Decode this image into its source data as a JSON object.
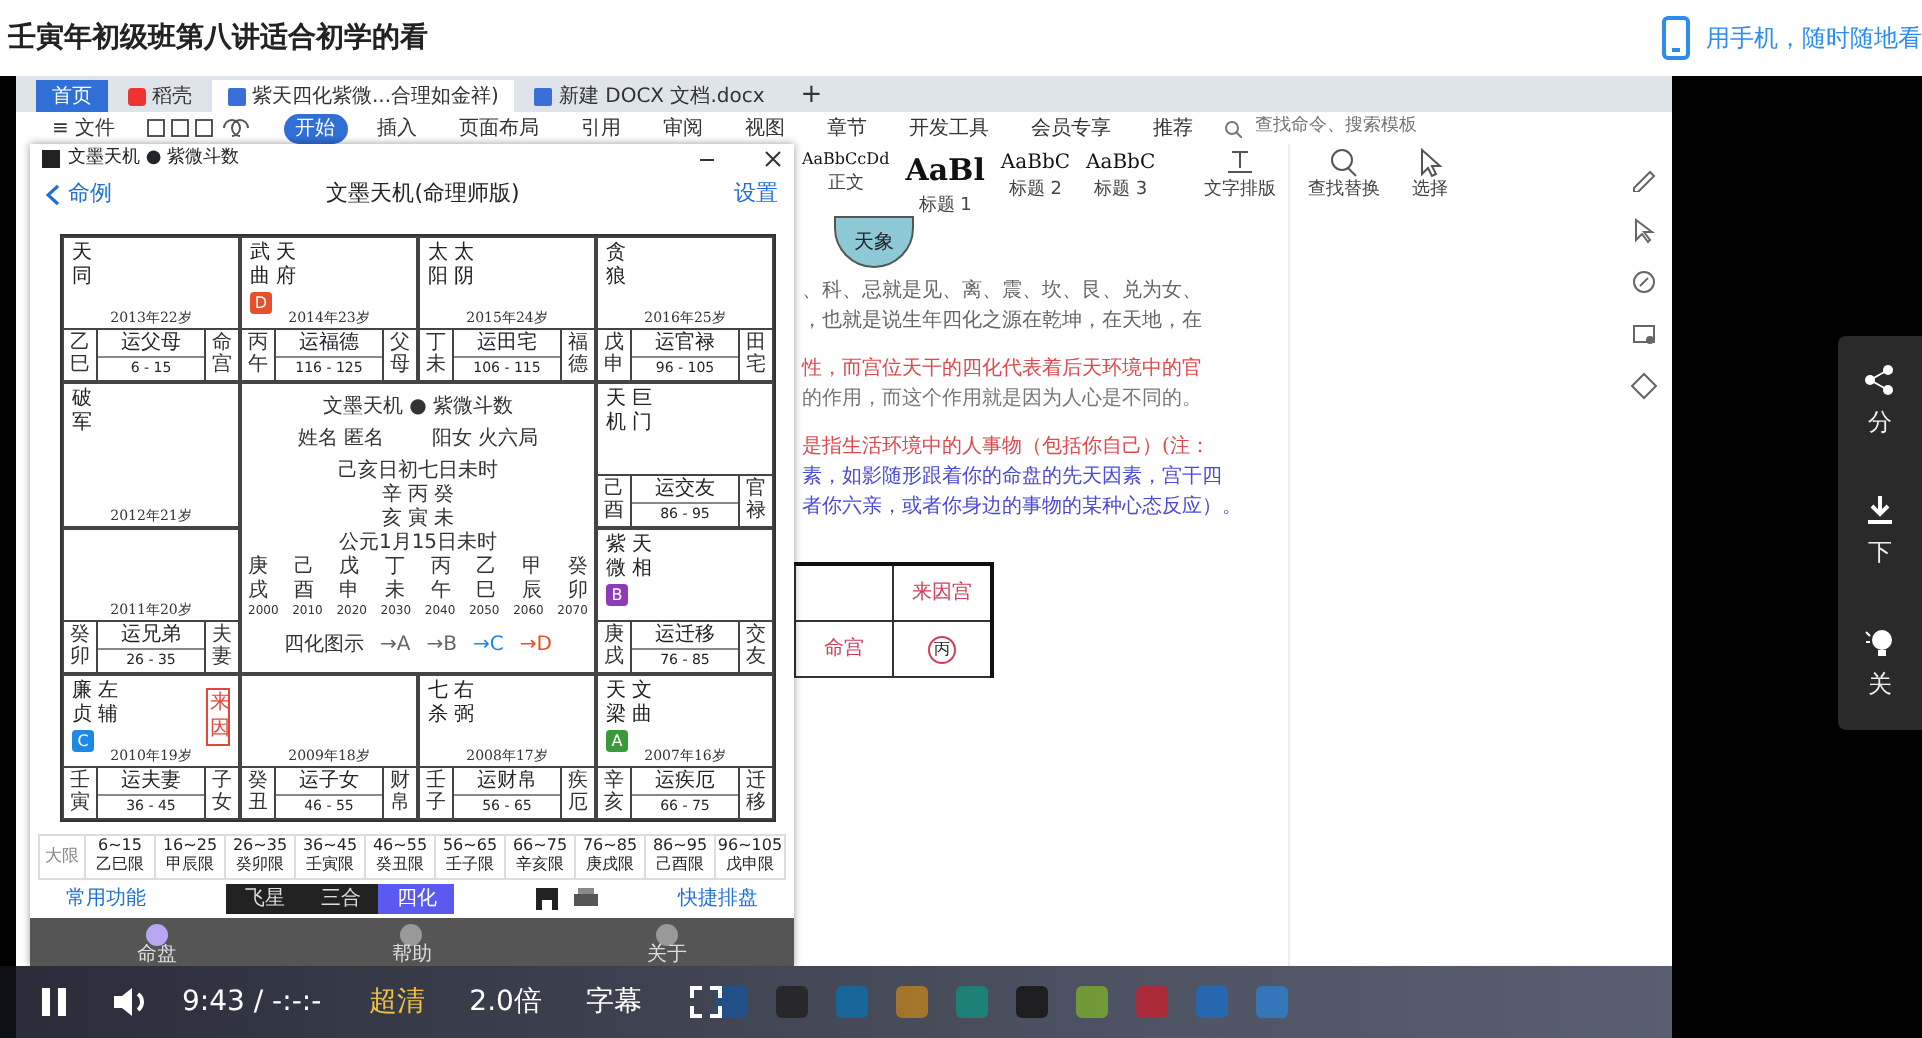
{
  "page_title": "壬寅年初级班第八讲适合初学的看",
  "mobile_link": "用手机，随时随地看",
  "browser_tabs": [
    {
      "label": "首页",
      "kind": "home",
      "selected": false
    },
    {
      "label": "稻壳",
      "kind": "app",
      "selected": false
    },
    {
      "label": "紫天四化紫微...合理如金祥)",
      "kind": "doc",
      "selected": true
    },
    {
      "label": "新建 DOCX 文档.docx",
      "kind": "doc",
      "selected": false
    },
    {
      "label": "+",
      "kind": "add",
      "selected": false
    }
  ],
  "ribbon_menu": [
    {
      "label": "≡ 文件",
      "selected": false
    },
    {
      "label": "开始",
      "selected": true
    },
    {
      "label": "插入",
      "selected": false
    },
    {
      "label": "页面布局",
      "selected": false
    },
    {
      "label": "引用",
      "selected": false
    },
    {
      "label": "审阅",
      "selected": false
    },
    {
      "label": "视图",
      "selected": false
    },
    {
      "label": "章节",
      "selected": false
    },
    {
      "label": "开发工具",
      "selected": false
    },
    {
      "label": "会员专享",
      "selected": false
    },
    {
      "label": "推荐",
      "selected": false
    }
  ],
  "command_search": {
    "placeholder": "查找命令、搜索模板"
  },
  "styles": [
    {
      "sample": "AaBbCcDd",
      "label": "正文",
      "kind": "small"
    },
    {
      "sample": "AaBl",
      "label": "标题 1",
      "kind": "large"
    },
    {
      "sample": "AaBbC",
      "label": "标题 2",
      "kind": "medium"
    },
    {
      "sample": "AaBbC",
      "label": "标题 3",
      "kind": "medium"
    }
  ],
  "ribbon_tools": [
    {
      "label": "文字排版",
      "kind": "text"
    },
    {
      "label": "查找替换",
      "kind": "search"
    },
    {
      "label": "选择",
      "kind": "cursor"
    }
  ],
  "document": {
    "circle_label": "天象",
    "lines": [
      {
        "text": "、科、忌就是见、离、震、坎、艮、兑为女、",
        "color": "#666666"
      },
      {
        "text": "，也就是说生年四化之源在乾坤，在天地，在",
        "color": "#666666"
      },
      {
        "text": "性，而宫位天干的四化代表着后天环境中的官",
        "color": "#e0484c"
      },
      {
        "text": "的作用，而这个作用就是因为人心是不同的。",
        "color": "#777777"
      },
      {
        "text": "是指生活环境中的人事物（包括你自己）(注：",
        "color": "#e0484c"
      },
      {
        "text": "素，如影随形跟着你的命盘的先天因素，宫干四",
        "color": "#4a4ad8"
      },
      {
        "text": "者你六亲，或者你身边的事物的某种心态反应）。",
        "color": "#4a4ad8"
      }
    ],
    "table": {
      "corner": "来因宫",
      "palace": "命宫",
      "stem": "丙"
    }
  },
  "chart_app": {
    "window_title": "文墨天机 ● 紫微斗数",
    "back": "命例",
    "title": "文墨天机(命理师版)",
    "settings": "设置",
    "palaces": [
      {
        "stars": [
          "天同"
        ],
        "year": "2013年22岁",
        "stem": "乙巳",
        "yun": "运父母",
        "range": "6 - 15",
        "name": "命宫"
      },
      {
        "stars": [
          "武曲",
          "天府"
        ],
        "badge": {
          "text": "D",
          "color": "#e8502c"
        },
        "year": "2014年23岁",
        "stem": "丙午",
        "yun": "运福德",
        "range": "116 - 125",
        "name": "父母"
      },
      {
        "stars": [
          "太阳",
          "太阴"
        ],
        "year": "2015年24岁",
        "stem": "丁未",
        "yun": "运田宅",
        "range": "106 - 115",
        "name": "福德"
      },
      {
        "stars": [
          "贪狼"
        ],
        "year": "2016年25岁",
        "stem": "戊申",
        "yun": "运官禄",
        "range": "96 - 105",
        "name": "田宅"
      },
      {
        "stars": [
          "破军"
        ],
        "year": "2012年21岁"
      },
      {
        "stars": [
          "天机",
          "巨门"
        ],
        "stem": "己酉",
        "yun": "运交友",
        "range": "86 - 95",
        "name": "官禄"
      },
      {
        "year": "2011年20岁",
        "stem": "癸卯",
        "yun": "运兄弟",
        "range": "26 - 35",
        "name": "夫妻"
      },
      {
        "stars": [
          "紫微",
          "天相"
        ],
        "badge": {
          "text": "B",
          "color": "#8e3bb8"
        },
        "stem": "庚戌",
        "yun": "运迁移",
        "range": "76 - 85",
        "name": "交友"
      },
      {
        "stars": [
          "廉贞",
          "左辅"
        ],
        "badge": {
          "text": "C",
          "color": "#1e88e5"
        },
        "tag": "来因",
        "year": "2010年19岁",
        "stem": "壬寅",
        "yun": "运夫妻",
        "range": "36 - 45",
        "name": "子女"
      },
      {
        "year": "2009年18岁",
        "stem": "癸丑",
        "yun": "运子女",
        "range": "46 - 55",
        "name": "财帛"
      },
      {
        "stars": [
          "七杀",
          "右弼"
        ],
        "year": "2008年17岁",
        "stem": "壬子",
        "yun": "运财帛",
        "range": "56 - 65",
        "name": "疾厄"
      },
      {
        "stars": [
          "天梁",
          "文曲"
        ],
        "badge": {
          "text": "A",
          "color": "#3a9a3a"
        },
        "year": "2007年16岁",
        "stem": "辛亥",
        "yun": "运疾厄",
        "range": "66 - 75",
        "name": "迁移"
      }
    ],
    "center": {
      "title": "文墨天机 ● 紫微斗数",
      "info": [
        "姓名 匿名",
        "阳女 火六局"
      ],
      "birth": [
        "己亥日初七日未时",
        "辛 丙 癸",
        "亥 寅 未",
        "公元1月15日未时"
      ],
      "stems": [
        "庚",
        "己",
        "戊",
        "丁",
        "丙",
        "乙",
        "甲",
        "癸"
      ],
      "branches": [
        "戌",
        "酉",
        "申",
        "未",
        "午",
        "巳",
        "辰",
        "卯"
      ],
      "years": [
        "2000",
        "2010",
        "2020",
        "2030",
        "2040",
        "2050",
        "2060",
        "2070"
      ],
      "legend_label": "四化图示",
      "legend": [
        {
          "text": "→A",
          "color": "#666666"
        },
        {
          "text": "→B",
          "color": "#666666"
        },
        {
          "text": "→C",
          "color": "#1e88e5"
        },
        {
          "text": "→D",
          "color": "#e8502c"
        }
      ]
    },
    "daxian_label": "大限",
    "daxian": [
      {
        "range": "6~15",
        "name": "乙巳限"
      },
      {
        "range": "16~25",
        "name": "甲辰限"
      },
      {
        "range": "26~35",
        "name": "癸卯限"
      },
      {
        "range": "36~45",
        "name": "壬寅限"
      },
      {
        "range": "46~55",
        "name": "癸丑限"
      },
      {
        "range": "56~65",
        "name": "壬子限"
      },
      {
        "range": "66~75",
        "name": "辛亥限"
      },
      {
        "range": "76~85",
        "name": "庚戌限"
      },
      {
        "range": "86~95",
        "name": "己酉限"
      },
      {
        "range": "96~105",
        "name": "戊申限"
      }
    ],
    "common": "常用功能",
    "modes": [
      {
        "label": "飞星",
        "selected": false
      },
      {
        "label": "三合",
        "selected": false
      },
      {
        "label": "四化",
        "selected": true
      }
    ],
    "quick": "快捷排盘",
    "bottom_tabs": [
      {
        "label": "命盘",
        "selected": true
      },
      {
        "label": "帮助",
        "selected": false
      },
      {
        "label": "关于",
        "selected": false
      }
    ]
  },
  "side_panel": [
    {
      "label": "分",
      "kind": "share"
    },
    {
      "label": "下",
      "kind": "download"
    },
    {
      "label": "关",
      "kind": "light"
    }
  ],
  "player": {
    "time": "9:43 / -:-:-",
    "quality": "超清",
    "speed": "2.0倍",
    "subtitles": "字幕",
    "playing": true
  }
}
